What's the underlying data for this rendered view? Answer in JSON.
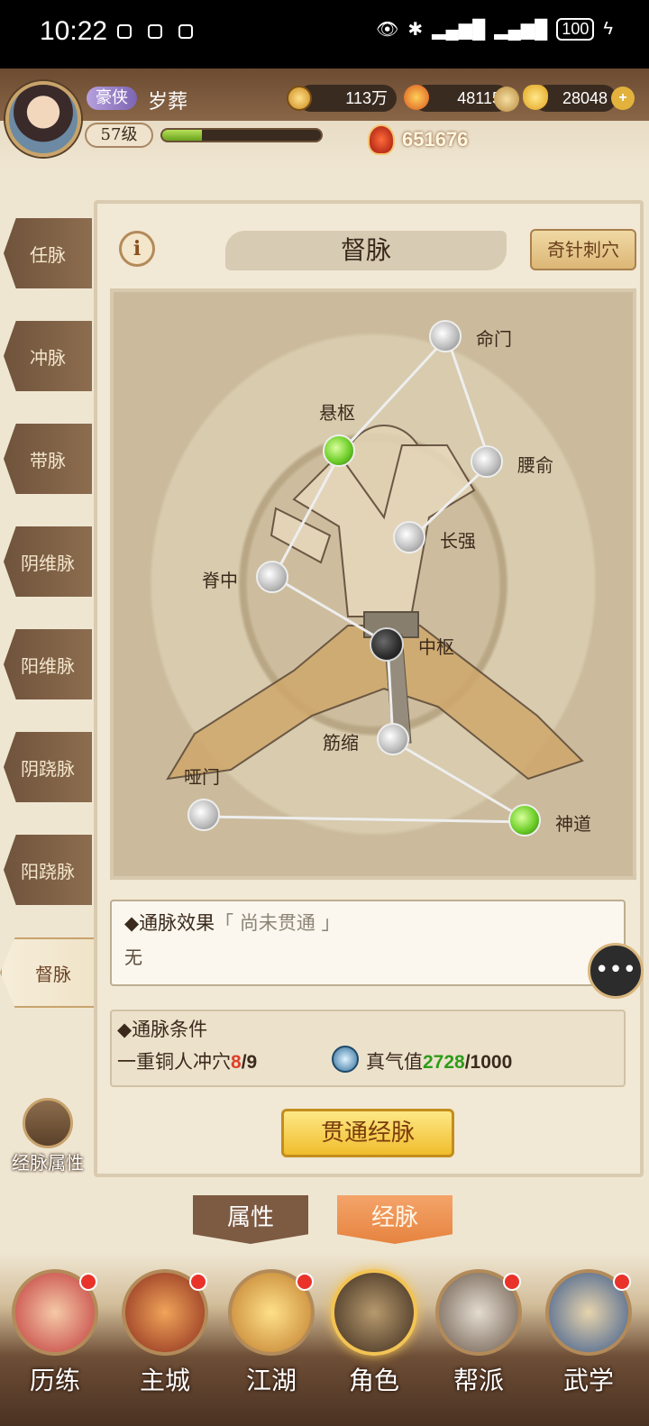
{
  "status_bar": {
    "time": "10:22",
    "battery": "100"
  },
  "player": {
    "title": "豪侠",
    "name": "岁葬",
    "level": "57级",
    "exp_fraction": 0.25,
    "combat_power": "651676"
  },
  "resources": {
    "coins": "113万",
    "energy": "48115",
    "ingots": "28048"
  },
  "meridian_tabs": [
    "任脉",
    "冲脉",
    "带脉",
    "阴维脉",
    "阳维脉",
    "阴跷脉",
    "阳跷脉",
    "督脉"
  ],
  "active_tab": "督脉",
  "attr_button_label": "经脉属性",
  "panel": {
    "title": "督脉",
    "info_icon": "i",
    "needle_button": "奇针刺穴"
  },
  "acupoints": [
    {
      "name": "命门",
      "state": "locked"
    },
    {
      "name": "悬枢",
      "state": "opened"
    },
    {
      "name": "腰俞",
      "state": "locked"
    },
    {
      "name": "长强",
      "state": "locked"
    },
    {
      "name": "脊中",
      "state": "locked"
    },
    {
      "name": "中枢",
      "state": "current"
    },
    {
      "name": "筋缩",
      "state": "locked"
    },
    {
      "name": "哑门",
      "state": "locked"
    },
    {
      "name": "神道",
      "state": "opened"
    }
  ],
  "effect": {
    "label": "◆通脉效果",
    "status": "「 尚未贯通 」",
    "value": "无"
  },
  "conditions": {
    "label": "◆通脉条件",
    "item1_label": "一重铜人冲穴",
    "item1_current": "8",
    "item1_sep": "/9",
    "item2_label": "真气值",
    "item2_current": "2728",
    "item2_sep": "/1000"
  },
  "open_button": "贯通经脉",
  "sub_tabs": [
    "属性",
    "经脉"
  ],
  "bottom_nav": [
    "历练",
    "主城",
    "江湖",
    "角色",
    "帮派",
    "武学"
  ],
  "colors": {
    "accent_gold": "#f0bd2c",
    "opened_point": "#6fcf2a",
    "alert_red": "#e9332a"
  }
}
